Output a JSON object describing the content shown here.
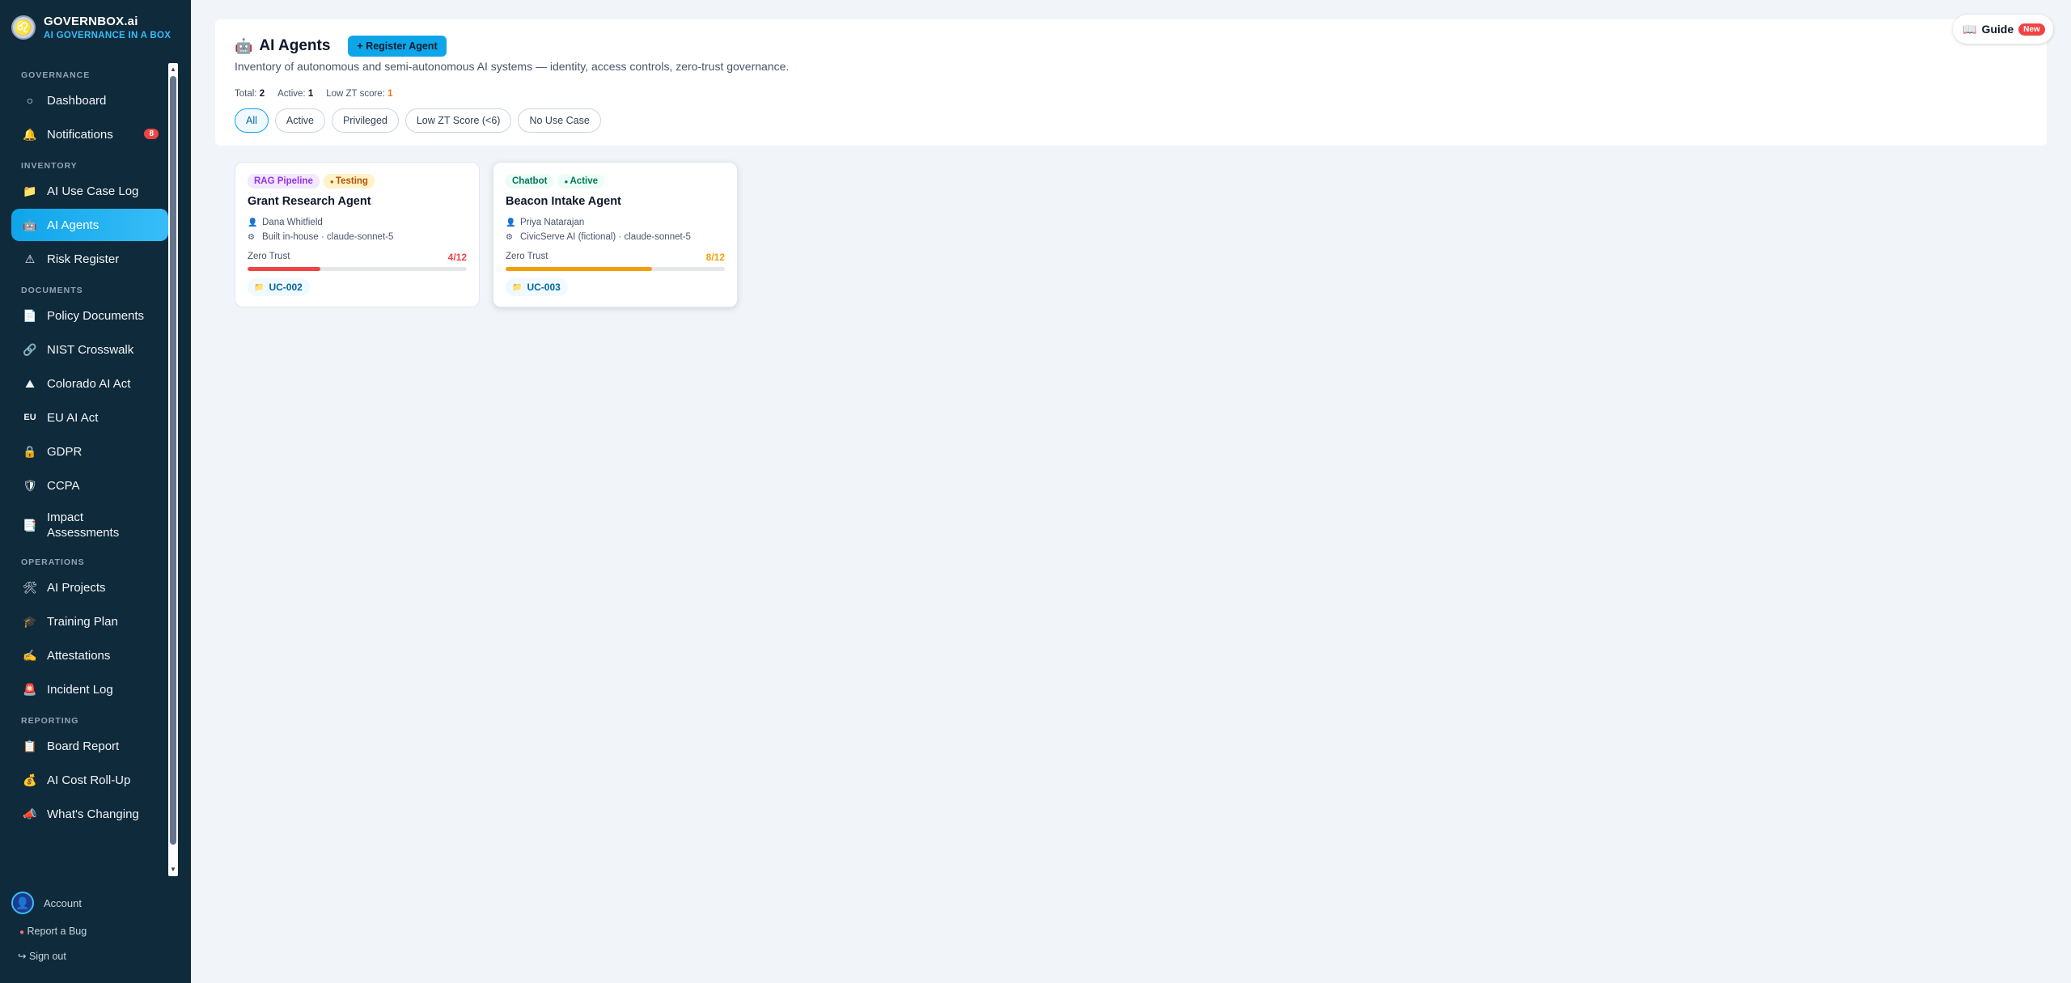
{
  "brand": {
    "name": "GOVERNBOX.ai",
    "tagline": "AI GOVERNANCE IN A BOX"
  },
  "sidebar": {
    "sections": [
      {
        "title": "GOVERNANCE",
        "items": [
          {
            "label": "Dashboard",
            "icon": "circle-icon",
            "glyph": "○"
          },
          {
            "label": "Notifications",
            "icon": "bell-icon",
            "glyph": "🔔",
            "badge": "8"
          }
        ]
      },
      {
        "title": "INVENTORY",
        "items": [
          {
            "label": "AI Use Case Log",
            "icon": "folder-icon",
            "glyph": "📁"
          },
          {
            "label": "AI Agents",
            "icon": "robot-icon",
            "glyph": "🤖",
            "active": true
          },
          {
            "label": "Risk Register",
            "icon": "warning-icon",
            "glyph": "⚠"
          }
        ]
      },
      {
        "title": "DOCUMENTS",
        "items": [
          {
            "label": "Policy Documents",
            "icon": "document-icon",
            "glyph": "📄"
          },
          {
            "label": "NIST Crosswalk",
            "icon": "link-icon",
            "glyph": "🔗"
          },
          {
            "label": "Colorado AI Act",
            "icon": "mountain-icon",
            "glyph": "⛰"
          },
          {
            "label": "EU AI Act",
            "icon": "eu-icon",
            "glyph": "EU"
          },
          {
            "label": "GDPR",
            "icon": "lock-icon",
            "glyph": "🔒"
          },
          {
            "label": "CCPA",
            "icon": "shield-icon",
            "glyph": "🛡"
          },
          {
            "label": "Impact Assessments",
            "icon": "report-icon",
            "glyph": "📑",
            "tall": true
          }
        ]
      },
      {
        "title": "OPERATIONS",
        "items": [
          {
            "label": "AI Projects",
            "icon": "tools-icon",
            "glyph": "🛠"
          },
          {
            "label": "Training Plan",
            "icon": "graduation-cap-icon",
            "glyph": "🎓"
          },
          {
            "label": "Attestations",
            "icon": "writing-hand-icon",
            "glyph": "✍"
          },
          {
            "label": "Incident Log",
            "icon": "siren-icon",
            "glyph": "🚨"
          }
        ]
      },
      {
        "title": "REPORTING",
        "items": [
          {
            "label": "Board Report",
            "icon": "clipboard-icon",
            "glyph": "📋"
          },
          {
            "label": "AI Cost Roll-Up",
            "icon": "money-bag-icon",
            "glyph": "💰"
          },
          {
            "label": "What's Changing",
            "icon": "megaphone-icon",
            "glyph": "📣"
          }
        ]
      }
    ],
    "account_label": "Account",
    "report_bug_label": "Report a Bug",
    "sign_out_label": "Sign out"
  },
  "header": {
    "title": "AI Agents",
    "register_label": "+ Register Agent",
    "subtitle": "Inventory of autonomous and semi-autonomous AI systems — identity, access controls, zero-trust governance.",
    "stats": {
      "total_label": "Total:",
      "total_value": "2",
      "active_label": "Active:",
      "active_value": "1",
      "low_zt_label": "Low ZT score:",
      "low_zt_value": "1"
    },
    "filters": [
      "All",
      "Active",
      "Privileged",
      "Low ZT Score (<6)",
      "No Use Case"
    ],
    "active_filter": "All"
  },
  "guide": {
    "label": "Guide",
    "badge": "New"
  },
  "agents": [
    {
      "type": "RAG Pipeline",
      "status": "Testing",
      "name": "Grant Research Agent",
      "owner": "Dana Whitfield",
      "vendor_model": "Built in-house · claude-sonnet-5",
      "zt_label": "Zero Trust",
      "zt_score": "4/12",
      "zt_fraction": 0.333,
      "zt_color": "#ef4444",
      "use_case": "UC-002"
    },
    {
      "type": "Chatbot",
      "status": "Active",
      "name": "Beacon Intake Agent",
      "owner": "Priya Natarajan",
      "vendor_model": "CivicServe AI (fictional) · claude-sonnet-5",
      "zt_label": "Zero Trust",
      "zt_score": "8/12",
      "zt_fraction": 0.667,
      "zt_color": "#f59e0b",
      "use_case": "UC-003"
    }
  ],
  "colors": {
    "accent": "#0ea5e9",
    "sidebar_bg": "#0f2a3a",
    "danger": "#ef4444",
    "warning": "#f59e0b"
  }
}
